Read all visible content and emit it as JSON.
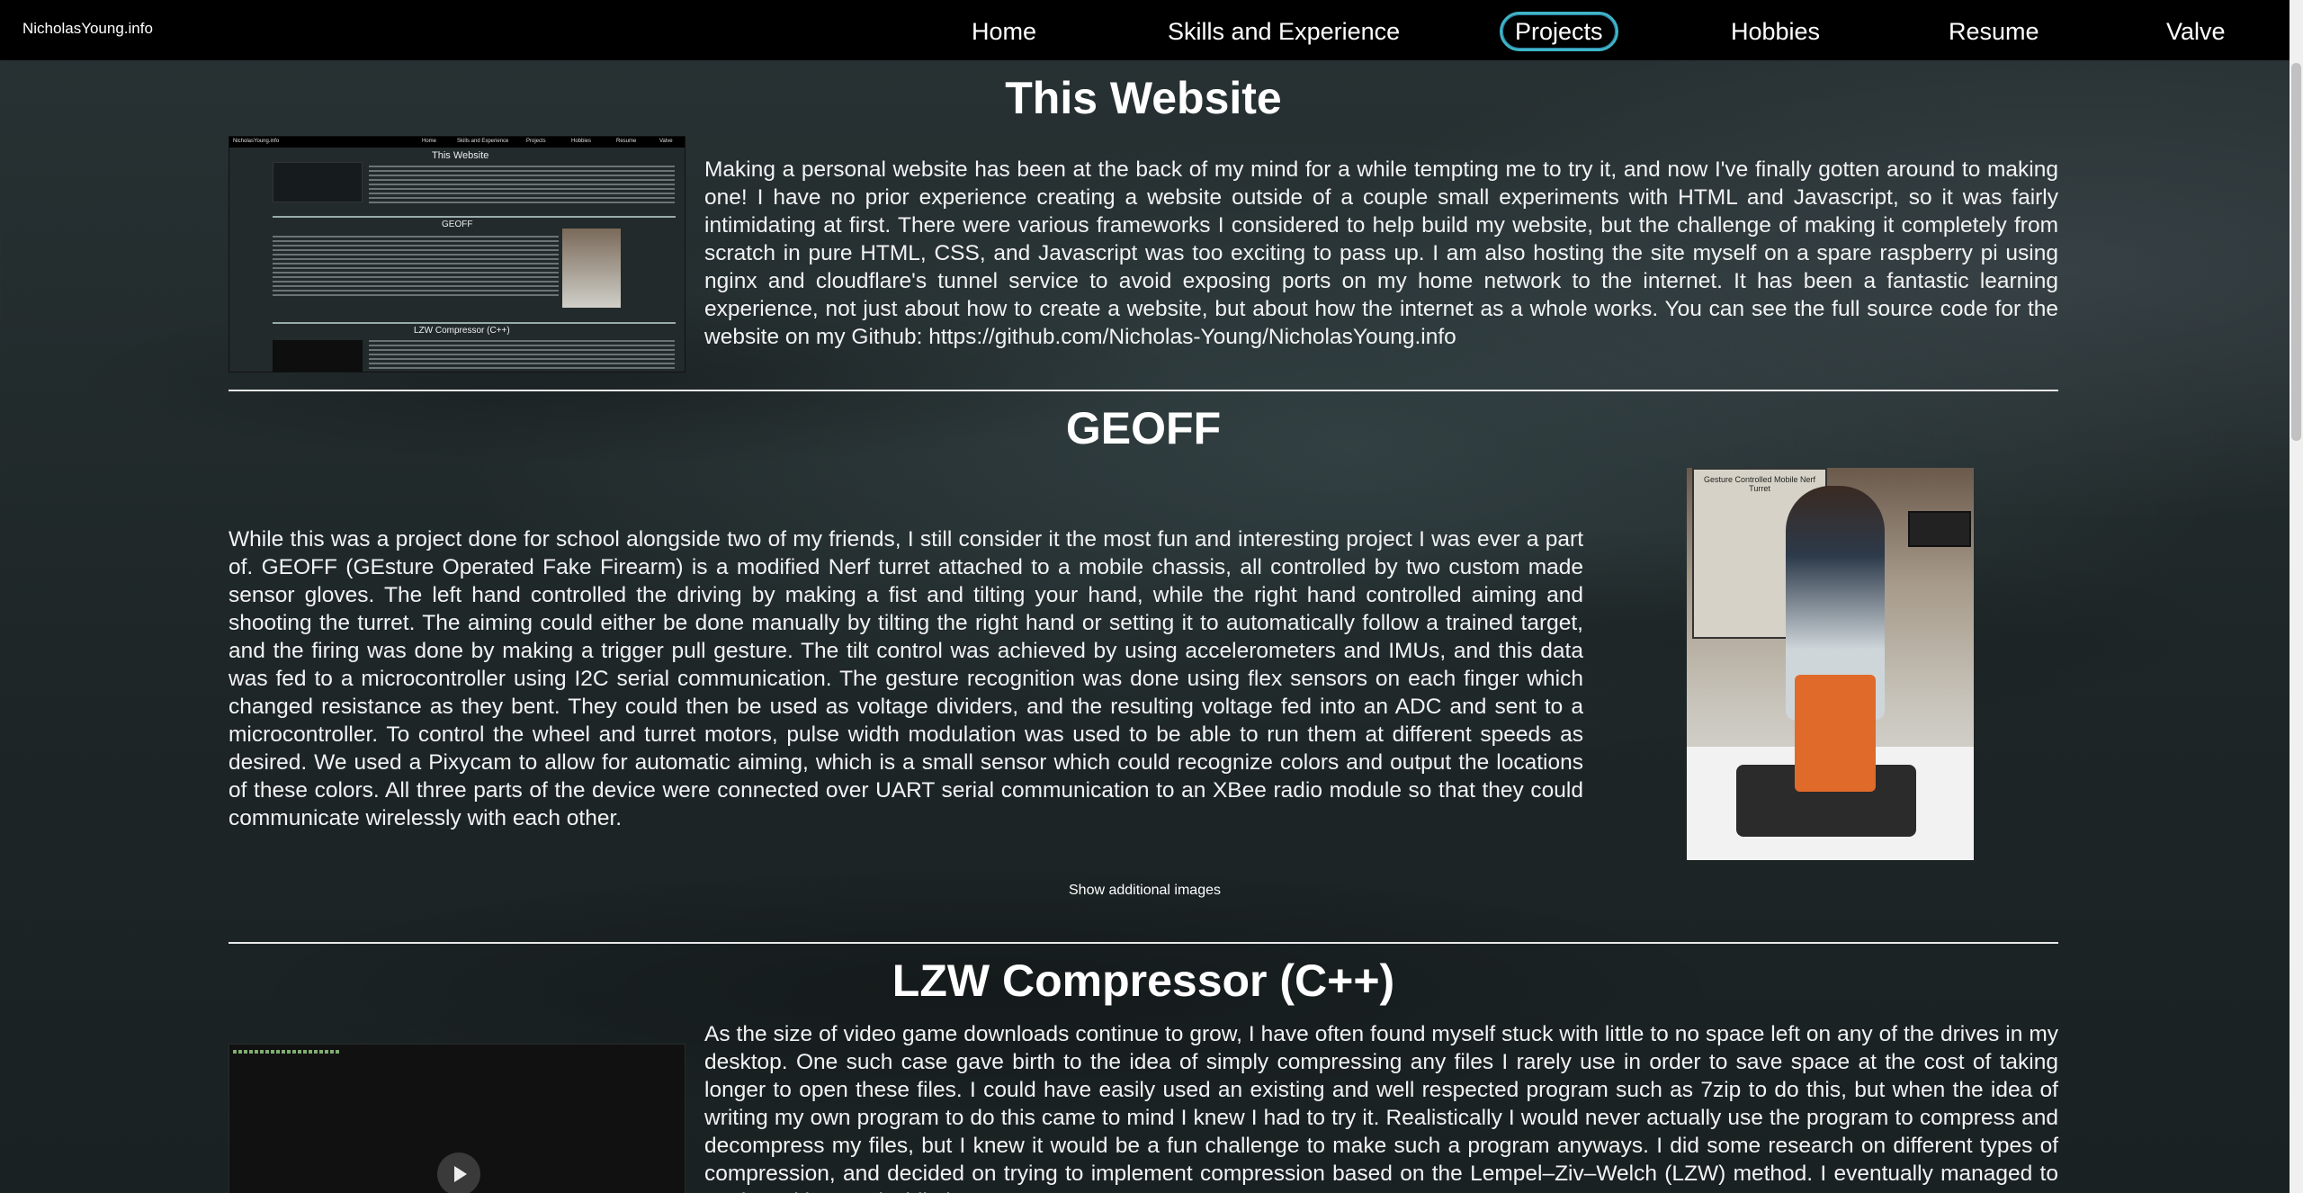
{
  "nav": {
    "brand": "NicholasYoung.info",
    "items": [
      {
        "label": "Home",
        "active": false
      },
      {
        "label": "Skills and Experience",
        "active": false
      },
      {
        "label": "Projects",
        "active": true
      },
      {
        "label": "Hobbies",
        "active": false
      },
      {
        "label": "Resume",
        "active": false
      },
      {
        "label": "Valve",
        "active": false
      }
    ]
  },
  "sections": {
    "website": {
      "title": "This Website",
      "text": "Making a personal website has been at the back of my mind for a while tempting me to try it, and now I've finally gotten around to making one! I have no prior experience creating a website outside of a couple small experiments with HTML and Javascript, so it was fairly intimidating at first. There were various frameworks I considered to help build my website, but the challenge of making it completely from scratch in pure HTML, CSS, and Javascript was too exciting to pass up. I am also hosting the site myself on a spare raspberry pi using nginx and cloudflare's tunnel service to avoid exposing ports on my home network to the internet. It has been a fantastic learning experience, not just about how to create a website, but about how the internet as a whole works. You can see the full source code for the website on my Github: https://github.com/Nicholas-Young/NicholasYoung.info"
    },
    "geoff": {
      "title": "GEOFF",
      "text": "While this was a project done for school alongside two of my friends, I still consider it the most fun and interesting project I was ever a part of. GEOFF (GEsture Operated Fake Firearm) is a modified Nerf turret attached to a mobile chassis, all controlled by two custom made sensor gloves. The left hand controlled the driving by making a fist and tilting your hand, while the right hand controlled aiming and shooting the turret. The aiming could either be done manually by tilting the right hand or setting it to automatically follow a trained target, and the firing was done by making a trigger pull gesture. The tilt control was achieved by using accelerometers and IMUs, and this data was fed to a microcontroller using I2C serial communication. The gesture recognition was done using flex sensors on each finger which changed resistance as they bent. They could then be used as voltage dividers, and the resulting voltage fed into an ADC and sent to a microcontroller. To control the wheel and turret motors, pulse width modulation was used to be able to run them at different speeds as desired. We used a Pixycam to allow for automatic aiming, which is a small sensor which could recognize colors and output the locations of these colors. All three parts of the device were connected over UART serial communication to an XBee radio module so that they could communicate wirelessly with each other.",
      "show_more": "Show additional images",
      "photo_poster_text": "Gesture Controlled Mobile Nerf Turret"
    },
    "lzw": {
      "title": "LZW Compressor (C++)",
      "text": "As the size of video game downloads continue to grow, I have often found myself stuck with little to no space left on any of the drives in my desktop. One such case gave birth to the idea of simply compressing any files I rarely use in order to save space at the cost of taking longer to open these files. I could have easily used an existing and well respected program such as 7zip to do this, but when the idea of writing my own program to do this came to mind I knew I had to try it. Realistically I would never actually use the program to compress and decompress my files, but I knew it would be a fun challenge to make such a program anyways. I did some research on different types of compression, and decided on trying to implement compression based on the Lempel–Ziv–Welch (LZW) method. I eventually managed to get it working, and while it wasn't"
    }
  },
  "thumb_site": {
    "brand": "NicholasYoung.info",
    "nav": [
      "Home",
      "Skills and Experience",
      "Projects",
      "Hobbies",
      "Resume",
      "Valve"
    ],
    "title_1": "This Website",
    "title_2": "GEOFF",
    "title_3": "LZW Compressor (C++)"
  },
  "icons": {
    "play": "play-icon"
  }
}
